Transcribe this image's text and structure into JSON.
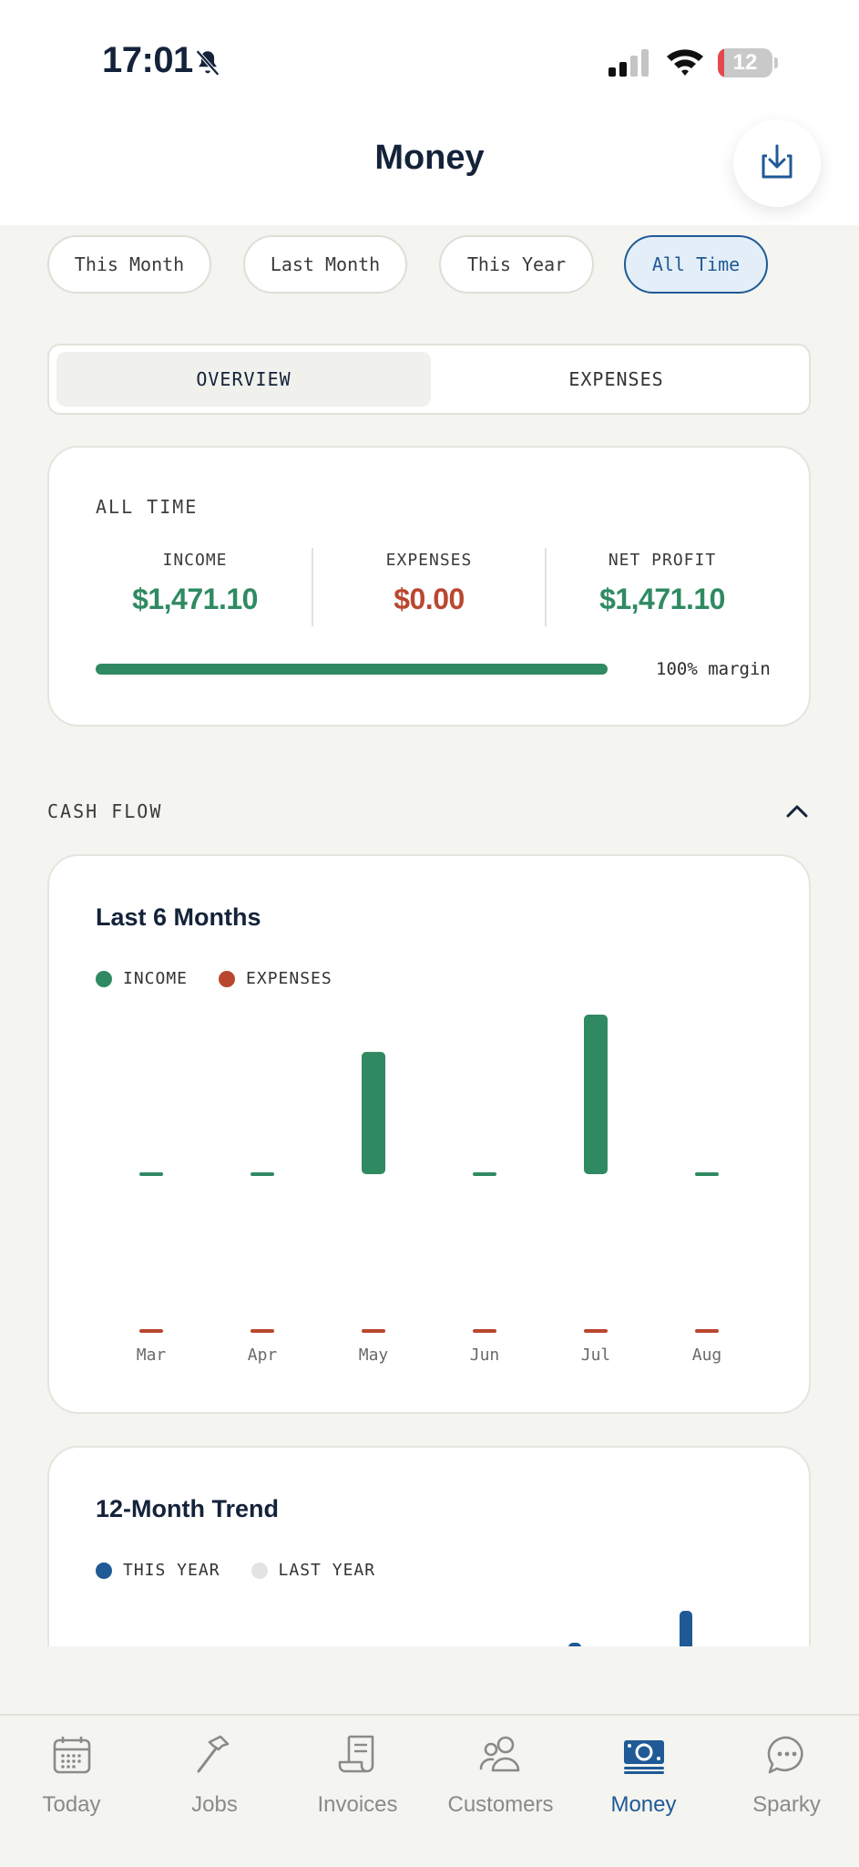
{
  "status_bar": {
    "time": "17:01",
    "battery": "12",
    "battery_level": 0.12
  },
  "header": {
    "title": "Money"
  },
  "filters": [
    {
      "label": "This Month",
      "active": false
    },
    {
      "label": "Last Month",
      "active": false
    },
    {
      "label": "This Year",
      "active": false
    },
    {
      "label": "All Time",
      "active": true
    }
  ],
  "segments": {
    "overview": "OVERVIEW",
    "expenses": "EXPENSES",
    "active": "OVERVIEW"
  },
  "summary": {
    "period": "ALL TIME",
    "income_label": "INCOME",
    "income_value": "$1,471.10",
    "expenses_label": "EXPENSES",
    "expenses_value": "$0.00",
    "profit_label": "NET PROFIT",
    "profit_value": "$1,471.10",
    "margin_percent": 100,
    "margin_text": "100% margin"
  },
  "cash_flow": {
    "title": "CASH FLOW"
  },
  "colors": {
    "income": "#2f8a62",
    "expenses": "#b9472f",
    "this_year": "#1f5a96",
    "last_year": "#e3e3e3",
    "accent": "#1f5a96"
  },
  "chart_data": [
    {
      "type": "bar",
      "title": "Last 6 Months",
      "categories": [
        "Mar",
        "Apr",
        "May",
        "Jun",
        "Jul",
        "Aug"
      ],
      "series": [
        {
          "name": "INCOME",
          "values": [
            0,
            0,
            590,
            0,
            770,
            0
          ]
        },
        {
          "name": "EXPENSES",
          "values": [
            0,
            0,
            0,
            0,
            0,
            0
          ]
        }
      ]
    },
    {
      "type": "bar",
      "title": "12-Month Trend",
      "series": [
        {
          "name": "THIS YEAR"
        },
        {
          "name": "LAST YEAR"
        }
      ]
    }
  ],
  "tabs": [
    {
      "label": "Today",
      "icon": "calendar-icon",
      "active": false
    },
    {
      "label": "Jobs",
      "icon": "hammer-icon",
      "active": false
    },
    {
      "label": "Invoices",
      "icon": "receipt-icon",
      "active": false
    },
    {
      "label": "Customers",
      "icon": "people-icon",
      "active": false
    },
    {
      "label": "Money",
      "icon": "money-icon",
      "active": true
    },
    {
      "label": "Sparky",
      "icon": "chat-icon",
      "active": false
    }
  ]
}
